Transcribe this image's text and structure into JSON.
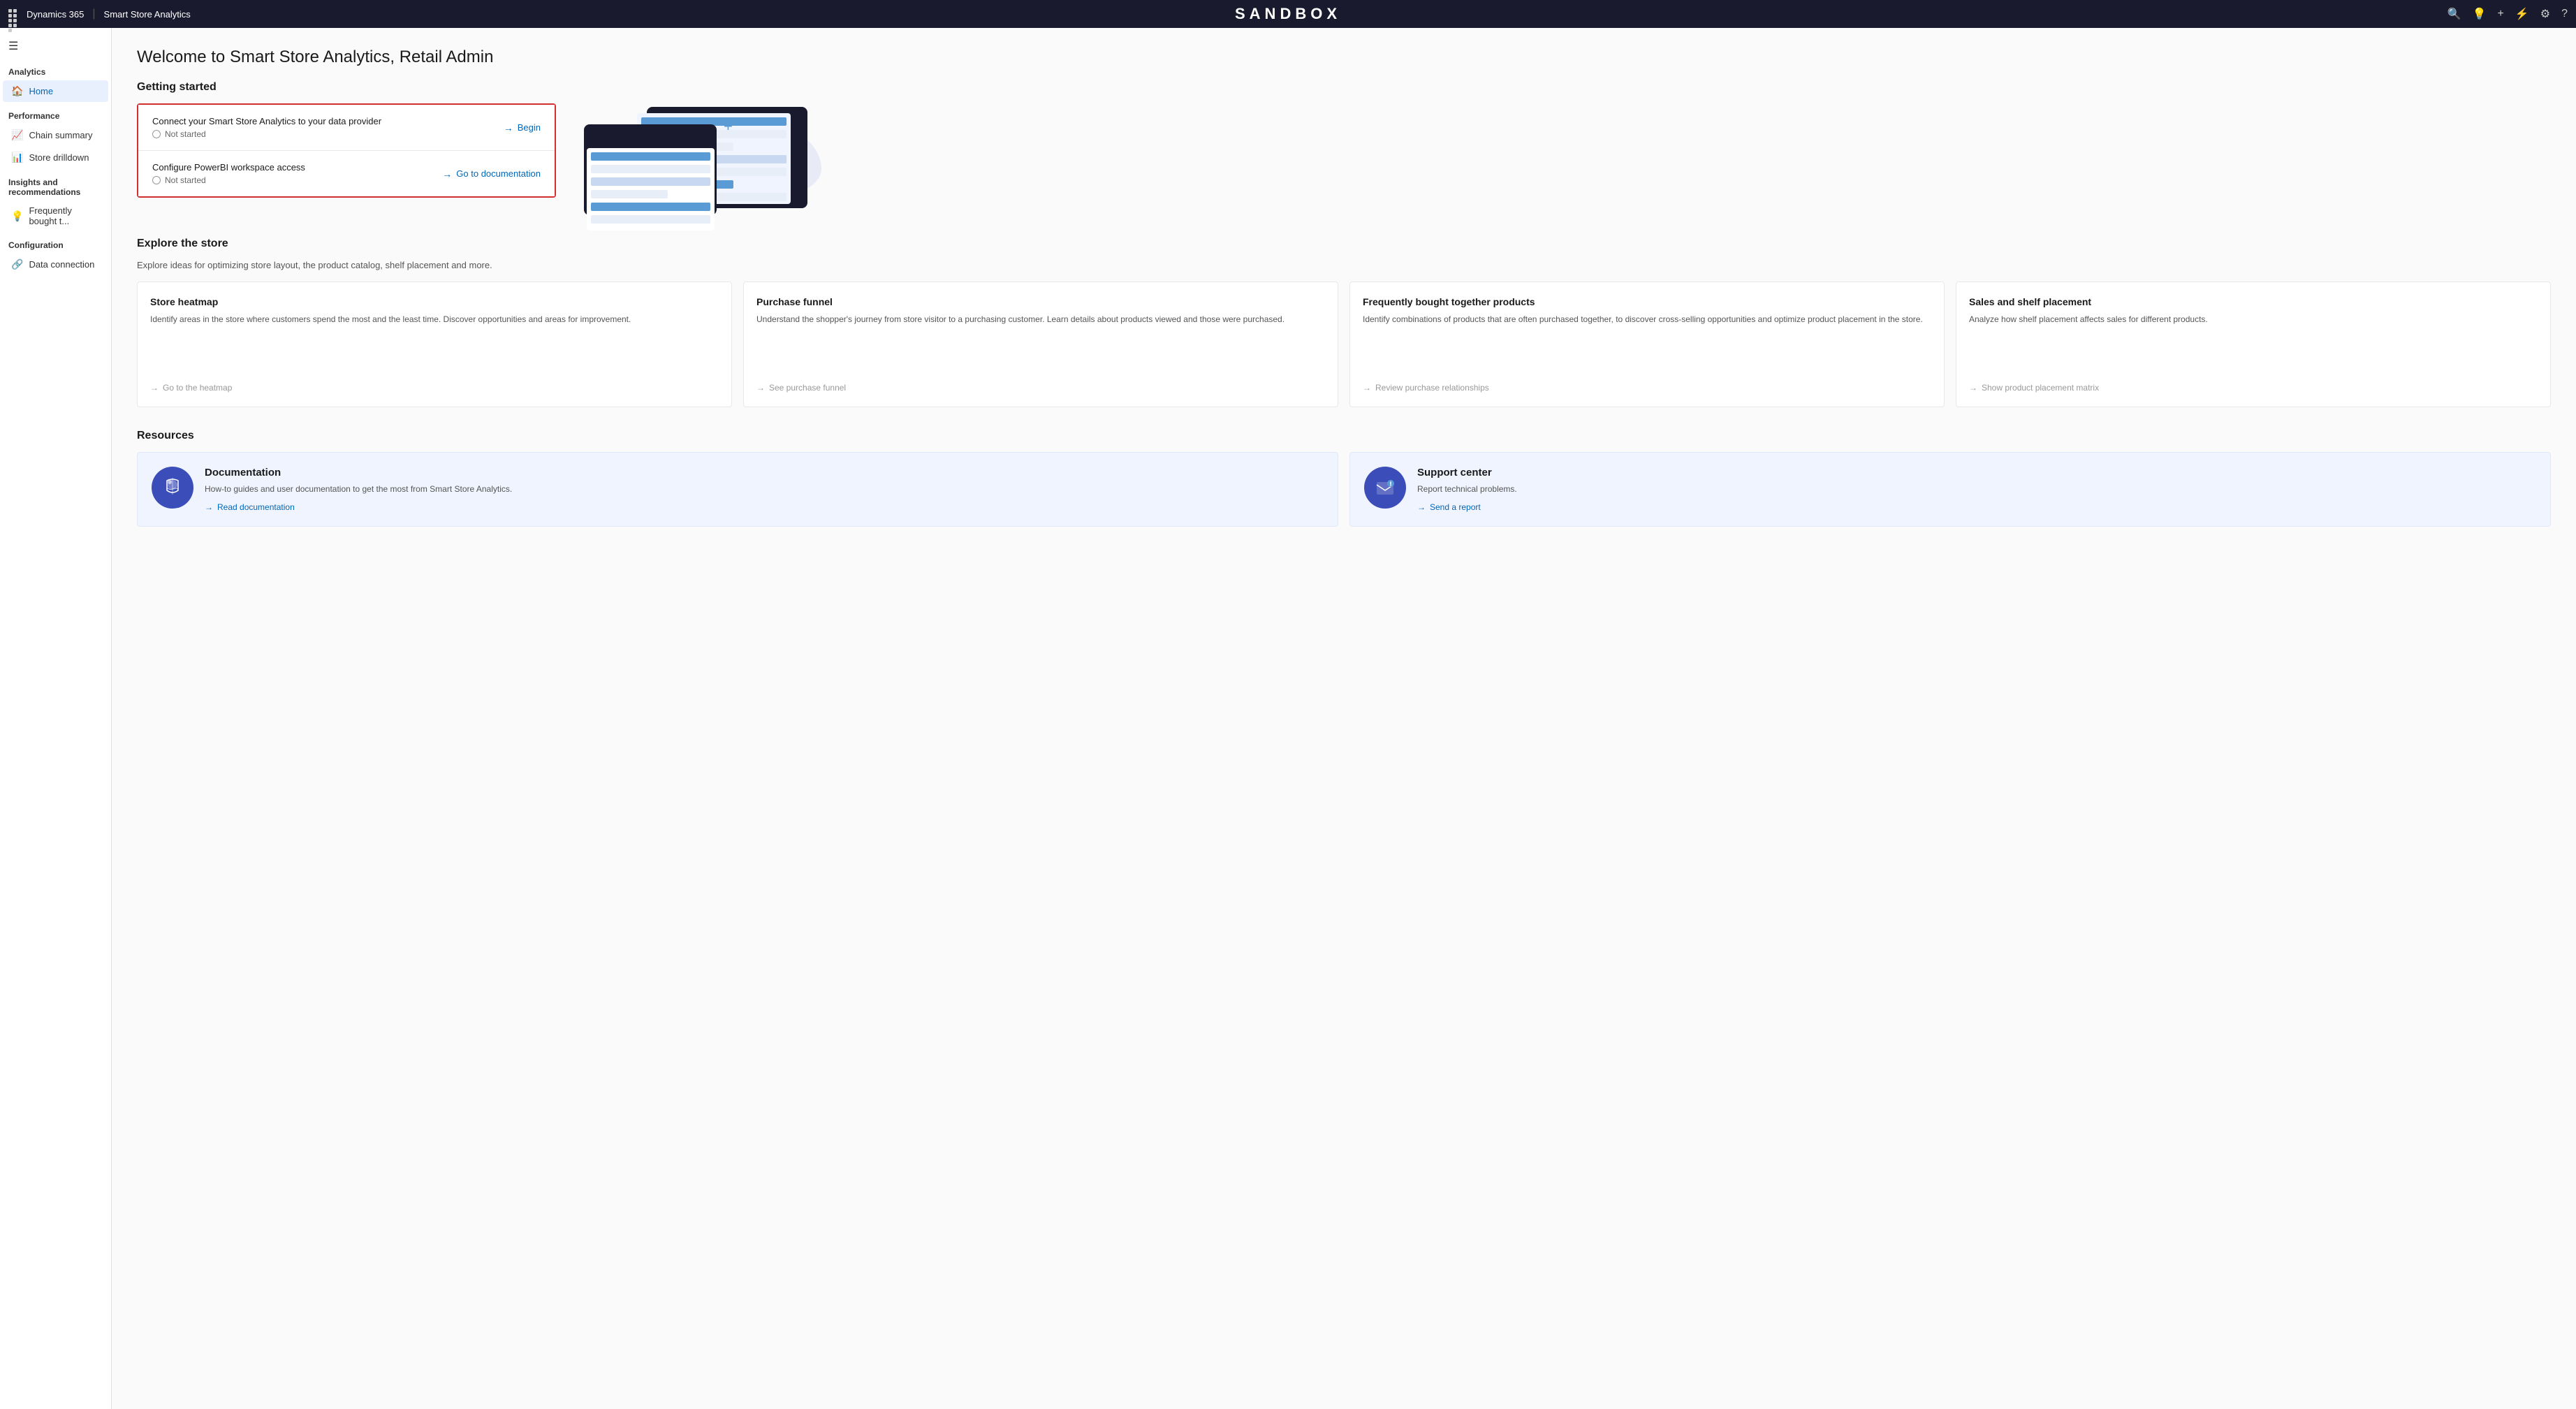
{
  "topbar": {
    "grid_label": "grid",
    "appname": "Dynamics 365",
    "separator": "|",
    "module": "Smart Store Analytics",
    "sandbox": "SANDBOX",
    "icons": {
      "search": "🔍",
      "help": "💡",
      "plus": "+",
      "filter": "⚡",
      "settings": "⚙",
      "question": "?"
    }
  },
  "sidebar": {
    "hamburger": "☰",
    "sections": [
      {
        "label": "Analytics",
        "items": [
          {
            "id": "home",
            "icon": "🏠",
            "label": "Home",
            "active": true
          }
        ]
      },
      {
        "label": "Performance",
        "items": [
          {
            "id": "chain-summary",
            "icon": "📈",
            "label": "Chain summary",
            "active": false
          },
          {
            "id": "store-drilldown",
            "icon": "📊",
            "label": "Store drilldown",
            "active": false
          }
        ]
      },
      {
        "label": "Insights and recommendations",
        "items": [
          {
            "id": "frequently-bought",
            "icon": "💡",
            "label": "Frequently bought t...",
            "active": false
          }
        ]
      },
      {
        "label": "Configuration",
        "items": [
          {
            "id": "data-connection",
            "icon": "🔗",
            "label": "Data connection",
            "active": false
          }
        ]
      }
    ]
  },
  "main": {
    "page_title": "Welcome to Smart Store Analytics, Retail Admin",
    "getting_started": {
      "section_title": "Getting started",
      "steps": [
        {
          "title": "Connect your Smart Store Analytics to your data provider",
          "status": "Not started",
          "action_label": "Begin"
        },
        {
          "title": "Configure PowerBI workspace access",
          "status": "Not started",
          "action_label": "Go to documentation"
        }
      ]
    },
    "explore": {
      "section_title": "Explore the store",
      "description": "Explore ideas for optimizing store layout, the product catalog, shelf placement and more.",
      "cards": [
        {
          "title": "Store heatmap",
          "desc": "Identify areas in the store where customers spend the most and the least time. Discover opportunities and areas for improvement.",
          "link": "Go to the heatmap"
        },
        {
          "title": "Purchase funnel",
          "desc": "Understand the shopper's journey from store visitor to a purchasing customer. Learn details about products viewed and those were purchased.",
          "link": "See purchase funnel"
        },
        {
          "title": "Frequently bought together products",
          "desc": "Identify combinations of products that are often purchased together, to discover cross-selling opportunities and optimize product placement in the store.",
          "link": "Review purchase relationships"
        },
        {
          "title": "Sales and shelf placement",
          "desc": "Analyze how shelf placement affects sales for different products.",
          "link": "Show product placement matrix"
        }
      ]
    },
    "resources": {
      "section_title": "Resources",
      "items": [
        {
          "title": "Documentation",
          "desc": "How-to guides and user documentation to get the most from Smart Store Analytics.",
          "link": "Read documentation"
        },
        {
          "title": "Support center",
          "desc": "Report technical problems.",
          "link": "Send a report"
        }
      ]
    }
  }
}
